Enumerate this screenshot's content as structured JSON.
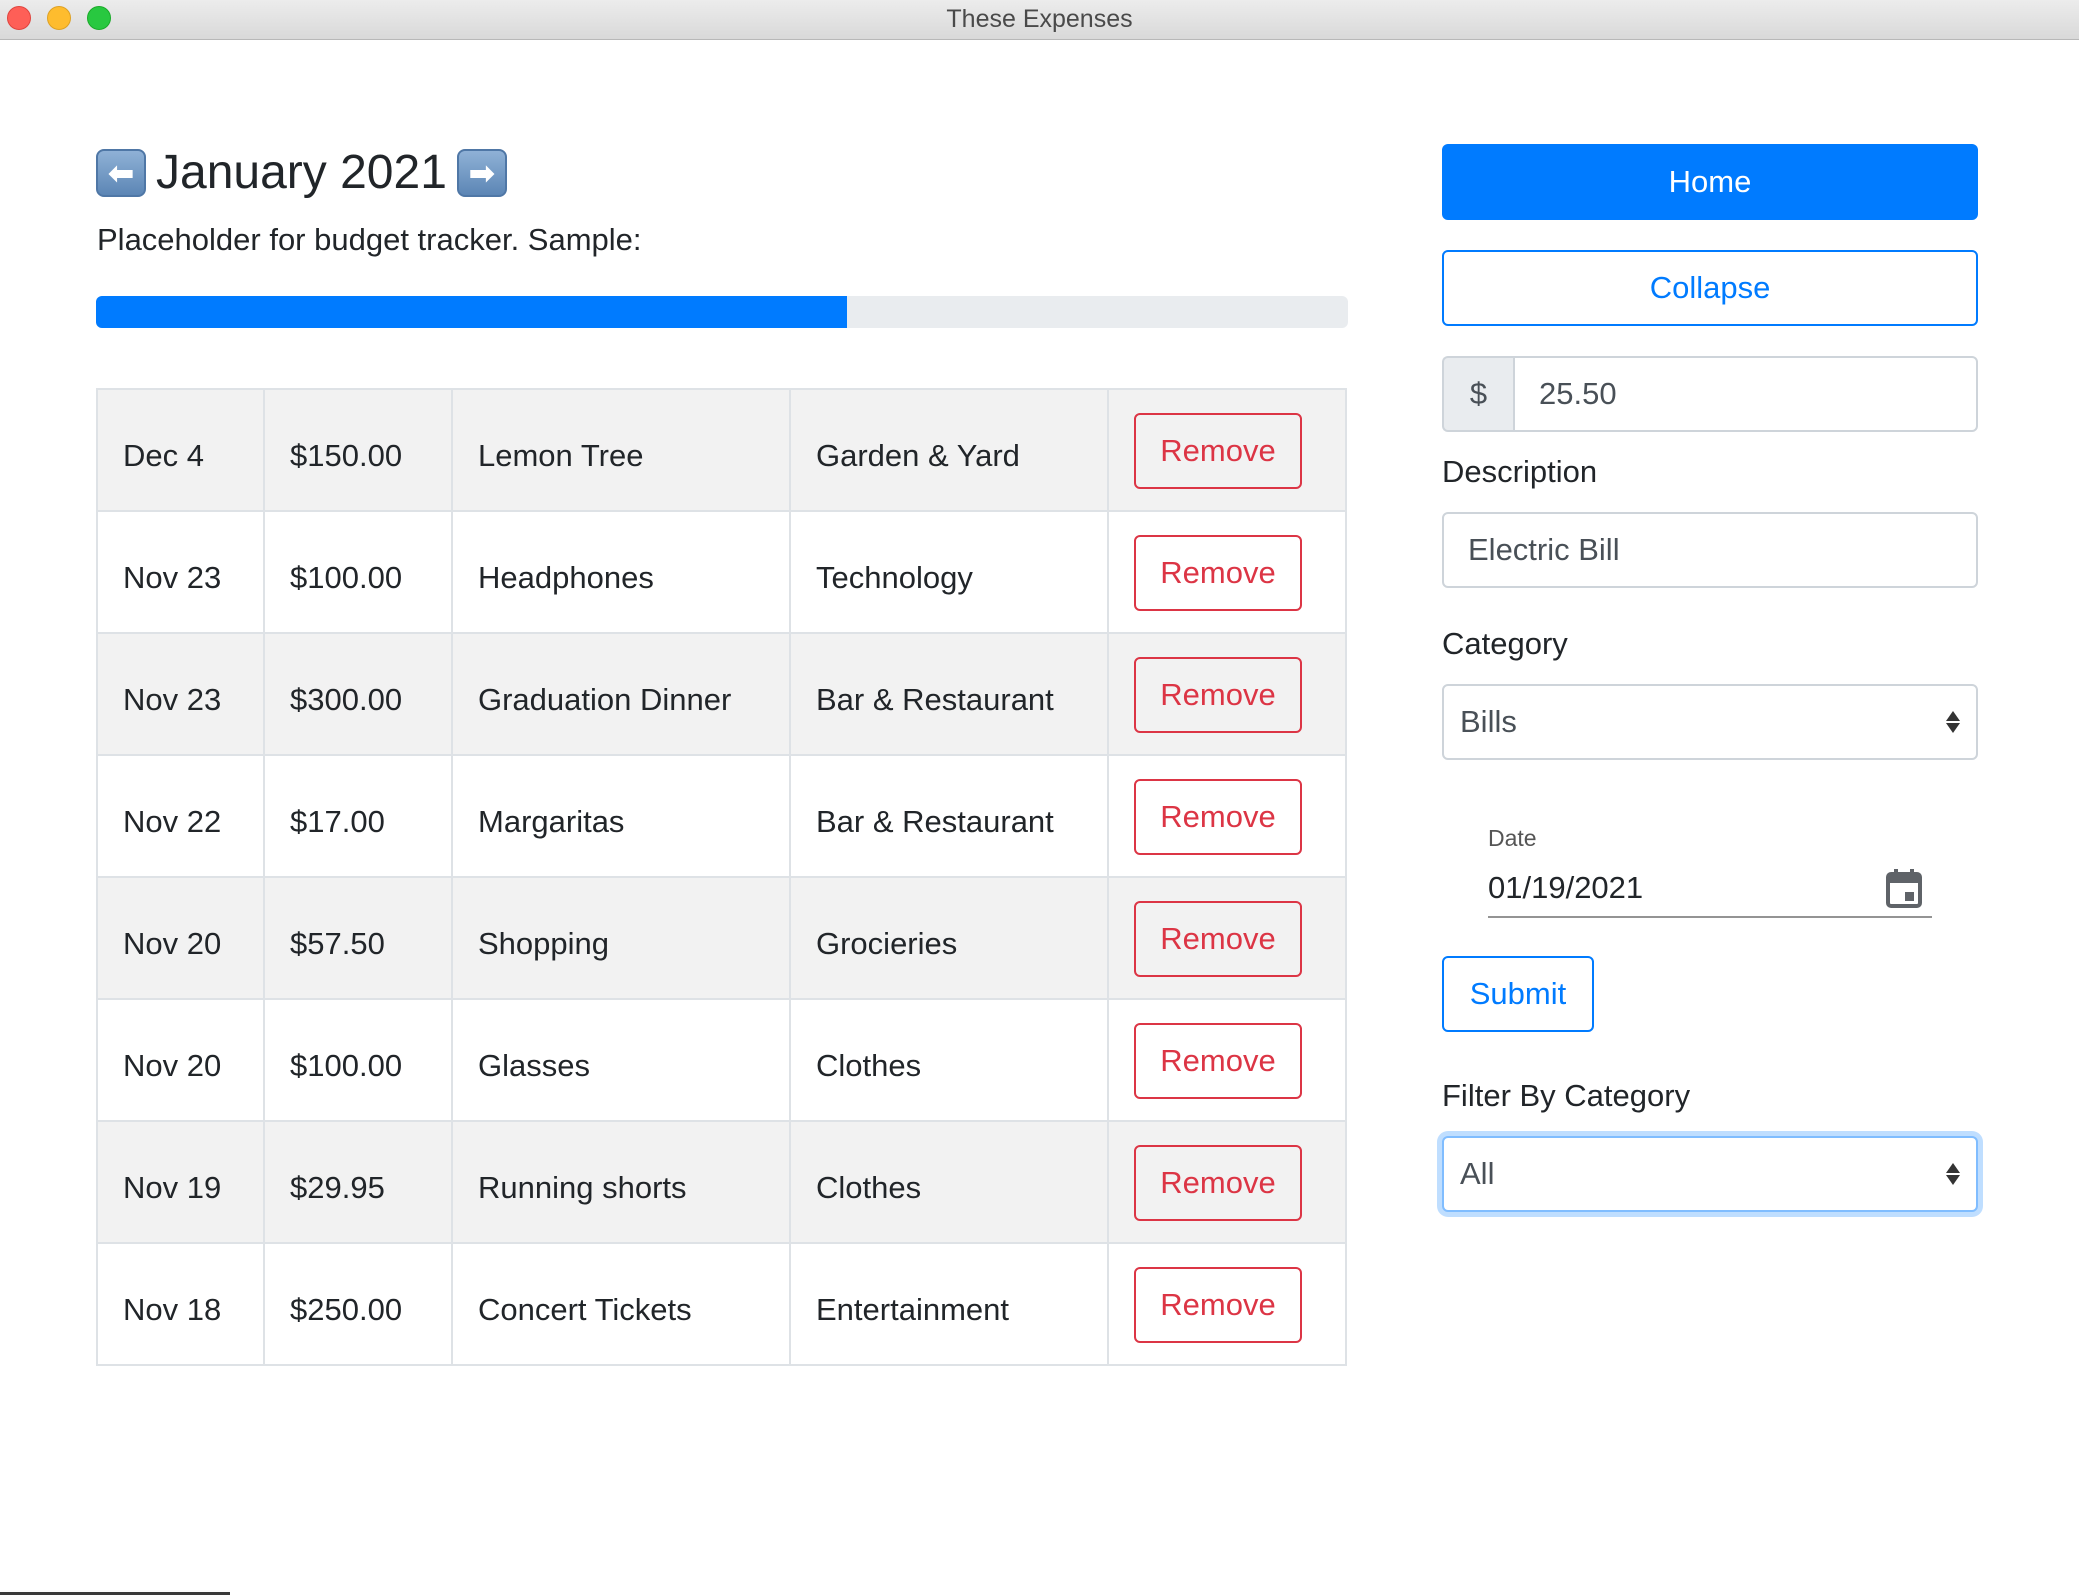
{
  "window": {
    "title": "These Expenses"
  },
  "header": {
    "month_title": "January 2021",
    "prev_icon": "left-arrow-icon",
    "next_icon": "right-arrow-icon"
  },
  "budget": {
    "text": "Placeholder for budget tracker. Sample:",
    "progress_percent": 60,
    "bar_color": "#007bff",
    "track_color": "#e9ecef"
  },
  "expenses": [
    {
      "date": "Dec 4",
      "amount": "$150.00",
      "description": "Lemon Tree",
      "category": "Garden & Yard",
      "action": "Remove"
    },
    {
      "date": "Nov 23",
      "amount": "$100.00",
      "description": "Headphones",
      "category": "Technology",
      "action": "Remove"
    },
    {
      "date": "Nov 23",
      "amount": "$300.00",
      "description": "Graduation Dinner",
      "category": "Bar & Restaurant",
      "action": "Remove"
    },
    {
      "date": "Nov 22",
      "amount": "$17.00",
      "description": "Margaritas",
      "category": "Bar & Restaurant",
      "action": "Remove"
    },
    {
      "date": "Nov 20",
      "amount": "$57.50",
      "description": "Shopping",
      "category": "Grocieries",
      "action": "Remove"
    },
    {
      "date": "Nov 20",
      "amount": "$100.00",
      "description": "Glasses",
      "category": "Clothes",
      "action": "Remove"
    },
    {
      "date": "Nov 19",
      "amount": "$29.95",
      "description": "Running shorts",
      "category": "Clothes",
      "action": "Remove"
    },
    {
      "date": "Nov 18",
      "amount": "$250.00",
      "description": "Concert Tickets",
      "category": "Entertainment",
      "action": "Remove"
    }
  ],
  "sidebar": {
    "home_label": "Home",
    "collapse_label": "Collapse",
    "amount_prefix": "$",
    "amount_value": "25.50",
    "description_label": "Description",
    "description_value": "Electric Bill",
    "category_label": "Category",
    "category_value": "Bills",
    "date_label": "Date",
    "date_value": "01/19/2021",
    "submit_label": "Submit",
    "filter_label": "Filter By Category",
    "filter_value": "All"
  },
  "colors": {
    "primary": "#007bff",
    "danger": "#dc3545",
    "stripe": "#f2f2f2"
  }
}
